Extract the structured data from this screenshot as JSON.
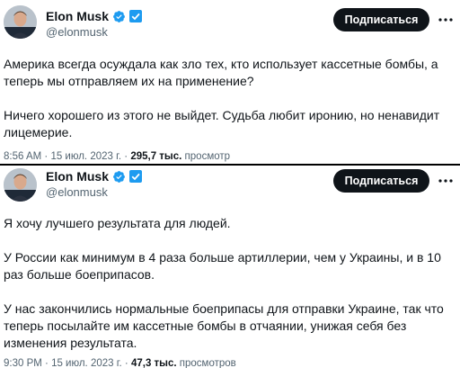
{
  "tweets": [
    {
      "author": {
        "name": "Elon Musk",
        "handle": "@elonmusk"
      },
      "subscribe_label": "Подписаться",
      "paragraphs": [
        "Америка всегда осуждала как зло тех, кто использует кассетные бомбы, а теперь мы отправляем их на применение?",
        "Ничего хорошего из этого не выйдет. Судьба любит иронию, но ненавидит лицемерие."
      ],
      "time": "8:56 AM",
      "sep1": " · ",
      "date": "15 июл. 2023 г.",
      "sep2": " · ",
      "views": "295,7 тыс.",
      "views_label": " просмотр"
    },
    {
      "author": {
        "name": "Elon Musk",
        "handle": "@elonmusk"
      },
      "subscribe_label": "Подписаться",
      "paragraphs": [
        "Я хочу лучшего результата для людей.",
        "У России как минимум в 4 раза больше артиллерии, чем у Украины, и в 10 раз больше боеприпасов.",
        "У нас закончились нормальные боеприпасы для отправки Украине, так что теперь посылайте им кассетные бомбы в отчаянии, унижая себя без изменения результата."
      ],
      "time": "9:30 PM",
      "sep1": " · ",
      "date": "15 июл. 2023 г.",
      "sep2": " · ",
      "views": "47,3 тыс.",
      "views_label": " просмотров"
    }
  ],
  "colors": {
    "verified_badge": "#1d9bf0",
    "subscribe_bg": "#0f1419",
    "secondary_text": "#536471"
  },
  "icons": {
    "verified": "verified-badge-icon",
    "affiliate": "square-badge-icon",
    "more": "more-icon"
  }
}
